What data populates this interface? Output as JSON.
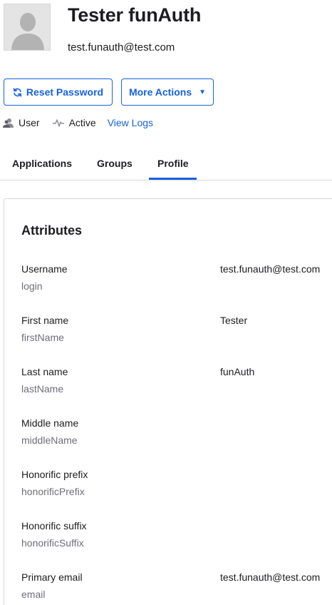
{
  "user": {
    "name": "Tester funAuth",
    "email": "test.funauth@test.com"
  },
  "actions": {
    "reset_label": "Reset Password",
    "more_label": "More Actions",
    "more_caret": "▼"
  },
  "meta": {
    "role": "User",
    "status": "Active",
    "logs_link": "View Logs"
  },
  "tabs": [
    {
      "label": "Applications",
      "active": false
    },
    {
      "label": "Groups",
      "active": false
    },
    {
      "label": "Profile",
      "active": true
    }
  ],
  "panel": {
    "title": "Attributes",
    "attributes": [
      {
        "label": "Username",
        "key": "login",
        "value": "test.funauth@test.com"
      },
      {
        "label": "First name",
        "key": "firstName",
        "value": "Tester"
      },
      {
        "label": "Last name",
        "key": "lastName",
        "value": "funAuth"
      },
      {
        "label": "Middle name",
        "key": "middleName",
        "value": ""
      },
      {
        "label": "Honorific prefix",
        "key": "honorificPrefix",
        "value": ""
      },
      {
        "label": "Honorific suffix",
        "key": "honorificSuffix",
        "value": ""
      },
      {
        "label": "Primary email",
        "key": "email",
        "value": "test.funauth@test.com"
      }
    ]
  },
  "colors": {
    "accent": "#1662dd",
    "text": "#1d1d21",
    "muted": "#6e6e78",
    "border": "#d7d7dc"
  },
  "icons": {
    "avatar": "user-silhouette-icon",
    "reset": "refresh-icon",
    "role": "user-icon",
    "status": "activity-icon"
  }
}
